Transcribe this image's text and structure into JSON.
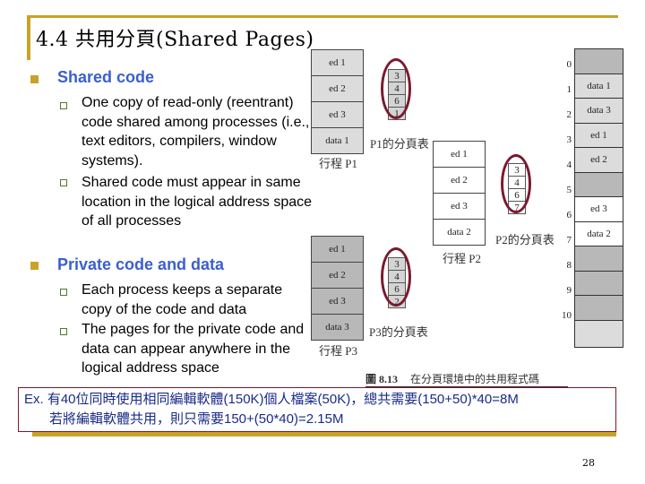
{
  "title": "4.4 共用分頁(Shared Pages)",
  "sections": [
    {
      "heading": "Shared code",
      "items": [
        "One copy of read-only (reentrant) code shared among processes (i.e., text editors, compilers, window systems).",
        "Shared code must appear in same location in the logical address space of all processes"
      ]
    },
    {
      "heading": "Private code and data",
      "items": [
        "Each process keeps a separate copy of the code and data",
        "The pages for the private code and data can appear anywhere in the logical address space"
      ]
    }
  ],
  "diagram": {
    "processes": [
      {
        "label": "行程 P1",
        "pages": [
          "ed 1",
          "ed 2",
          "ed 3",
          "data 1"
        ],
        "table_label": "P1的分頁表",
        "page_table": [
          "3",
          "4",
          "6",
          "1"
        ]
      },
      {
        "label": "行程 P2",
        "pages": [
          "ed 1",
          "ed 2",
          "ed 3",
          "data 2"
        ],
        "table_label": "P2的分頁表",
        "page_table": [
          "3",
          "4",
          "6",
          "7"
        ]
      },
      {
        "label": "行程 P3",
        "pages": [
          "ed 1",
          "ed 2",
          "ed 3",
          "data 3"
        ],
        "table_label": "P3的分頁表",
        "page_table": [
          "3",
          "4",
          "6",
          "2"
        ]
      }
    ],
    "physical_memory": {
      "frame_numbers": [
        "0",
        "1",
        "2",
        "3",
        "4",
        "5",
        "6",
        "7",
        "8",
        "9",
        "10"
      ],
      "frames": [
        "",
        "data 1",
        "data 3",
        "ed 1",
        "ed 2",
        "",
        "ed 3",
        "data 2",
        "",
        "",
        "",
        ""
      ]
    },
    "figure_caption_num": "圖 8.13",
    "figure_caption_text": "在分頁環境中的共用程式碼"
  },
  "example": {
    "line1": "Ex. 有40位同時使用相同編輯軟體(150K)個人檔案(50K)，總共需要(150+50)*40=8M",
    "line2": "若將編輯軟體共用，則只需要150+(50*40)=2.15M"
  },
  "colors": {
    "accent": "#c9a227",
    "heading": "#3a5fcd",
    "oval": "#7a1a2e",
    "example_text": "#1a2a8a"
  },
  "page_number": "28"
}
